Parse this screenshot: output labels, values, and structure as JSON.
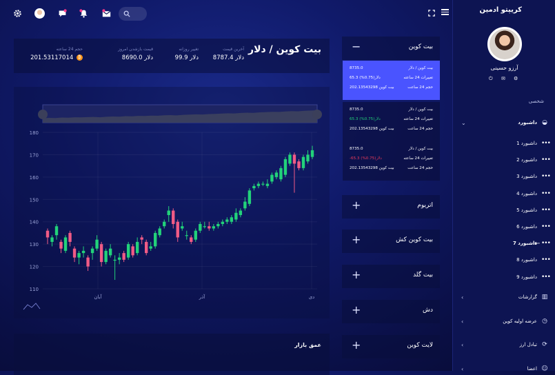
{
  "topbar": {
    "icons": [
      "settings-icon",
      "avatar",
      "chat-icon",
      "bell-icon",
      "mail-icon",
      "search-icon"
    ],
    "right_icons": [
      "fullscreen-icon",
      "menu-icon"
    ]
  },
  "sidebar": {
    "brand": "کریپتو ادمین",
    "user_name": "آرزو حسینی",
    "section_label": "شخصی",
    "items": [
      {
        "label": "داشبورد",
        "active": true,
        "icon": "dashboard-icon"
      },
      {
        "label": "داشبورد 1"
      },
      {
        "label": "داشبورد 2"
      },
      {
        "label": "داشبورد 3"
      },
      {
        "label": "داشبورد 4"
      },
      {
        "label": "داشبورد 5"
      },
      {
        "label": "داشبورد 6"
      },
      {
        "label": "داشبورد 7",
        "current": true
      },
      {
        "label": "داشبورد 8"
      },
      {
        "label": "داشبورد 9"
      },
      {
        "label": "گزارشات",
        "icon": "bar-chart-icon"
      },
      {
        "label": "عرضه اولیه کوین",
        "icon": "clock-icon"
      },
      {
        "label": "تبادل ارز",
        "icon": "exchange-icon"
      },
      {
        "label": "اعضا",
        "icon": "users-icon"
      }
    ]
  },
  "pair": {
    "title": "بیت کوین / دلار"
  },
  "stats": [
    {
      "label": "آخرین قیمت",
      "value": "8787.4 دلار"
    },
    {
      "label": "تغییر روزانه",
      "value": "99.9 دلار"
    },
    {
      "label": "قیمت بازشدن امروز",
      "value": "8690.0 دلار"
    },
    {
      "label": "حجم 24 ساعته",
      "value": "201.53117014"
    }
  ],
  "chart_data": {
    "type": "candlestick",
    "ylim": [
      110,
      180
    ],
    "yticks": [
      110,
      120,
      130,
      140,
      150,
      160,
      170,
      180
    ],
    "xticks": [
      "آبان",
      "آذر",
      "دی"
    ],
    "candles": [
      [
        136,
        133,
        137,
        130
      ],
      [
        131,
        133,
        134,
        129
      ],
      [
        134,
        138,
        139,
        132
      ],
      [
        131,
        128,
        132,
        126
      ],
      [
        127,
        133,
        134,
        126
      ],
      [
        135,
        131,
        136,
        129
      ],
      [
        128,
        124,
        129,
        122
      ],
      [
        124,
        126,
        127,
        121
      ],
      [
        126,
        127,
        129,
        124
      ],
      [
        124,
        120,
        125,
        118
      ],
      [
        126,
        128,
        129,
        123
      ],
      [
        128,
        132,
        134,
        127
      ],
      [
        130,
        122,
        131,
        120
      ],
      [
        122,
        127,
        128,
        121
      ],
      [
        125,
        128,
        130,
        124
      ],
      [
        123,
        123,
        125,
        114
      ],
      [
        123,
        124,
        126,
        121
      ],
      [
        126,
        123,
        127,
        122
      ],
      [
        124,
        130,
        131,
        123
      ],
      [
        129,
        125,
        130,
        124
      ],
      [
        126,
        131,
        133,
        125
      ],
      [
        133,
        132,
        134,
        130
      ],
      [
        131,
        126,
        132,
        125
      ],
      [
        128,
        129,
        131,
        127
      ],
      [
        129,
        135,
        136,
        128
      ],
      [
        134,
        137,
        138,
        133
      ],
      [
        138,
        140,
        141,
        137
      ],
      [
        143,
        145,
        147,
        140
      ],
      [
        145,
        139,
        146,
        137
      ],
      [
        140,
        133,
        141,
        131
      ],
      [
        137,
        138,
        140,
        136
      ],
      [
        134,
        134,
        136,
        132
      ],
      [
        133,
        131,
        134,
        130
      ],
      [
        132,
        136,
        137,
        131
      ],
      [
        136,
        139,
        140,
        135
      ],
      [
        138,
        138,
        140,
        137
      ],
      [
        138,
        137,
        140,
        136
      ],
      [
        137,
        138,
        139,
        136
      ],
      [
        138,
        139,
        140,
        137
      ],
      [
        139,
        140,
        141,
        138
      ],
      [
        140,
        141,
        142,
        139
      ],
      [
        140,
        142,
        143,
        139
      ],
      [
        141,
        144,
        146,
        140
      ],
      [
        143,
        145,
        146,
        142
      ],
      [
        146,
        149,
        151,
        145
      ],
      [
        148,
        154,
        155,
        147
      ],
      [
        155,
        156,
        157,
        154
      ],
      [
        156,
        157,
        158,
        155
      ],
      [
        157,
        157,
        158,
        156
      ],
      [
        156,
        157,
        159,
        155
      ],
      [
        158,
        161,
        162,
        157
      ],
      [
        160,
        162,
        163,
        159
      ],
      [
        159,
        164,
        165,
        158
      ],
      [
        161,
        168,
        169,
        160
      ],
      [
        166,
        170,
        171,
        165
      ],
      [
        170,
        166,
        171,
        153
      ],
      [
        167,
        164,
        168,
        163
      ],
      [
        164,
        169,
        170,
        163
      ],
      [
        167,
        170,
        172,
        166
      ],
      [
        169,
        172,
        174,
        168
      ]
    ],
    "navigator_values": [
      0.3,
      0.32,
      0.31,
      0.34,
      0.33,
      0.36,
      0.35,
      0.37,
      0.38,
      0.36,
      0.39,
      0.41,
      0.4,
      0.43,
      0.42,
      0.45,
      0.44,
      0.47,
      0.46,
      0.49,
      0.5,
      0.48,
      0.52,
      0.53,
      0.55,
      0.54,
      0.57,
      0.58,
      0.6,
      0.62,
      0.61,
      0.64,
      0.66,
      0.65,
      0.68,
      0.7,
      0.72,
      0.71,
      0.74,
      0.76,
      0.75,
      0.78,
      0.8,
      0.82
    ]
  },
  "depth": {
    "title": "عمق بازار"
  },
  "coins": {
    "bitcoin_header": "بیت کوین",
    "tickers": [
      {
        "pair": "بیت کوین / دلار",
        "price": "8735.0",
        "change_label": "تغییرات 24 ساعته",
        "change": "65.3 دلار(0.75%)",
        "volume_label": "حجم 24 ساعت",
        "volume": "202.13543298 بیت کوین",
        "highlight": true
      },
      {
        "pair": "بیت کوین / دلار",
        "price": "8735.0",
        "change_label": "تغییرات 24 ساعته",
        "change": "65.3 دلار(0.75%)",
        "volume_label": "حجم 24 ساعت",
        "volume": "202.13543298 بیت کوین",
        "change_color": "#22d27a"
      },
      {
        "pair": "بیت کوین / دلار",
        "price": "8735.0",
        "change_label": "تغییرات 24 ساعته",
        "change": "-65.3 دلار(0.75%)",
        "volume_label": "حجم 24 ساعت",
        "volume": "202.13543298 بیت کوین",
        "change_color": "#ef3b5c"
      }
    ],
    "others": [
      "اتریوم",
      "بیت کوین کش",
      "بیت گلد",
      "دش",
      "لایت کوین"
    ]
  },
  "colors": {
    "up": "#22d27a",
    "down": "#f05b86",
    "highlight": "#4a54ff"
  }
}
